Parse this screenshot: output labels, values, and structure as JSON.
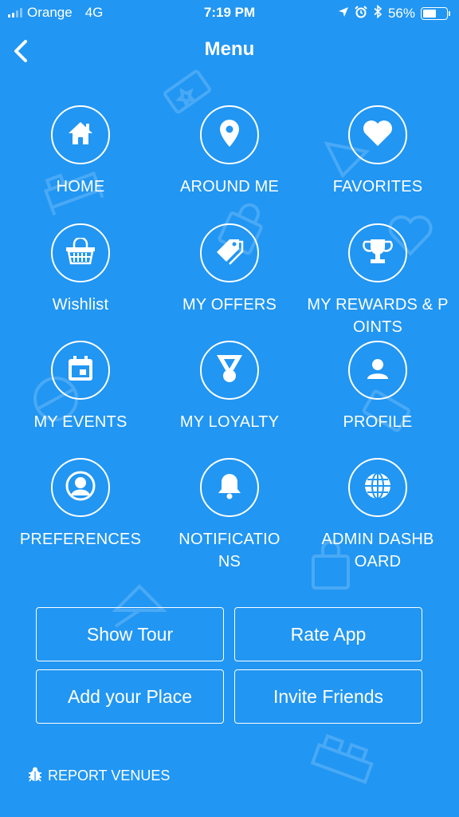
{
  "status_bar": {
    "carrier": "Orange",
    "network": "4G",
    "time": "7:19 PM",
    "battery_percent": "56%",
    "battery_level": 0.56,
    "icons": [
      "location-arrow-icon",
      "alarm-icon",
      "bluetooth-icon"
    ]
  },
  "nav": {
    "title": "Menu",
    "back_icon": "chevron-left-icon"
  },
  "menu": {
    "home": "HOME",
    "around_me": "AROUND ME",
    "favorites": "FAVORITES",
    "wishlist": "Wishlist",
    "my_offers": "MY OFFERS",
    "my_rewards": "MY REWARDS & POINTS",
    "my_events": "MY EVENTS",
    "my_loyalty": "MY LOYALTY",
    "profile": "PROFILE",
    "preferences": "PREFERENCES",
    "notifications": "NOTIFICATIONS",
    "admin_dashboard": "ADMIN DASHBOARD"
  },
  "actions": {
    "show_tour": "Show Tour",
    "rate_app": "Rate App",
    "add_place": "Add your Place",
    "invite_friends": "Invite Friends"
  },
  "footer": {
    "report_venues": "REPORT VENUES",
    "report_icon": "bug-icon"
  },
  "colors": {
    "background": "#2196f3",
    "foreground": "#ffffff"
  }
}
